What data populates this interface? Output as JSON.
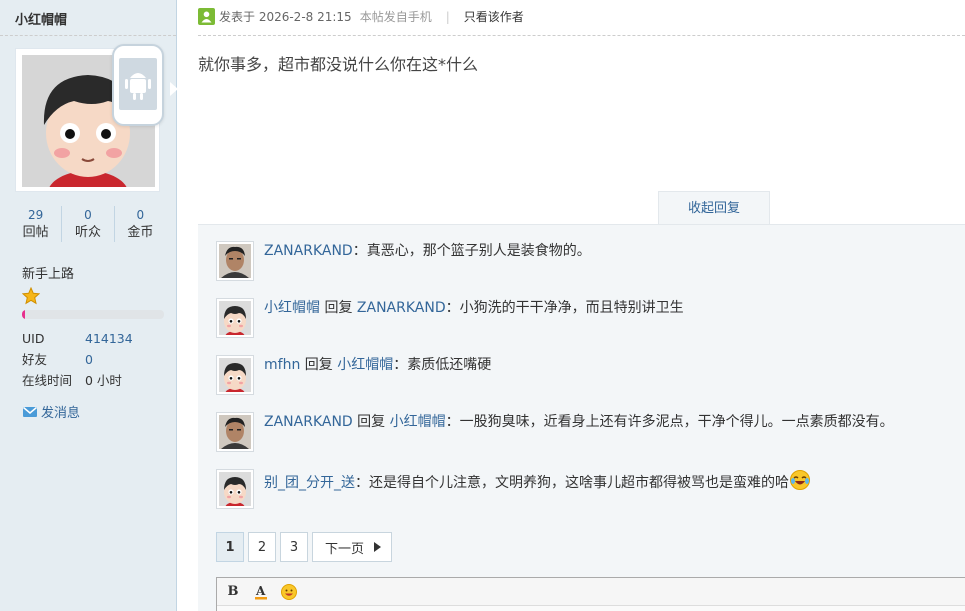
{
  "sidebar": {
    "username": "小红帽帽",
    "stats": [
      {
        "num": "29",
        "label": "回帖"
      },
      {
        "num": "0",
        "label": "听众"
      },
      {
        "num": "0",
        "label": "金币"
      }
    ],
    "rank": "新手上路",
    "level_progress": 0.02,
    "info": [
      {
        "key": "UID",
        "value": "414134"
      },
      {
        "key": "好友",
        "value": "0"
      },
      {
        "key": "在线时间",
        "value": "0 小时"
      }
    ],
    "send_message": "发消息"
  },
  "post": {
    "posted_on": "发表于 2026-2-8 21:15",
    "device": "本帖发自手机",
    "author_only": "只看该作者",
    "body": "就你事多，超市都没说什么你在这*什么"
  },
  "replies": {
    "collapse_label": "收起回复",
    "reply_word": "回复",
    "items": [
      {
        "user": "ZANARKAND",
        "reply_to": "",
        "text": "：真恶心，那个篮子别人是装食物的。",
        "avatar": "photo"
      },
      {
        "user": "小红帽帽",
        "reply_to": "ZANARKAND",
        "text": "：小狗洗的干干净净，而且特别讲卫生",
        "avatar": "cartoon"
      },
      {
        "user": "mfhn",
        "reply_to": "小红帽帽",
        "text": "：素质低还嘴硬",
        "avatar": "cartoon"
      },
      {
        "user": "ZANARKAND",
        "reply_to": "小红帽帽",
        "text": "：一股狗臭味，近看身上还有许多泥点，干净个得儿。一点素质都没有。",
        "avatar": "photo"
      },
      {
        "user": "别_团_分开_送",
        "reply_to": "",
        "text": "：还是得自个儿注意，文明养狗，这啥事儿超市都得被骂也是蛮难的哈",
        "avatar": "cartoon",
        "emoji": "laughing-crying-emoji"
      }
    ]
  },
  "pagination": {
    "pages": [
      "1",
      "2",
      "3"
    ],
    "current": "1",
    "next_label": "下一页"
  },
  "editor": {
    "bold": "B",
    "font_color": "A"
  },
  "colors": {
    "link": "#336699",
    "sidebar_bg": "#e5edf2",
    "reply_bg": "#f3f6f8",
    "progress": "#e72f8d"
  }
}
